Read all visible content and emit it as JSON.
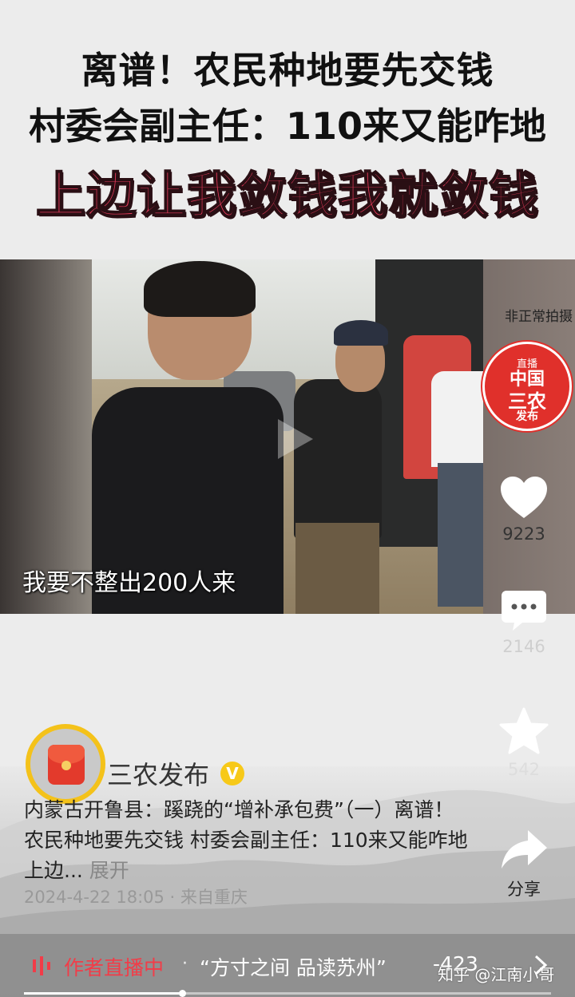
{
  "headline": {
    "line1": "离谱！农民种地要先交钱",
    "line2": "村委会副主任：110来又能咋地",
    "line3": "上边让我敛钱我就敛钱"
  },
  "video": {
    "subtitle": "我要不整出200人来",
    "watermark": "非正常拍摄"
  },
  "stamp": {
    "top": "直播",
    "line1": "中国",
    "line2": "三农",
    "line3": "发布"
  },
  "actions": {
    "likes": "9223",
    "comments": "2146",
    "favorites": "542",
    "share_label": "分享"
  },
  "author": {
    "name": "三农发布",
    "verified_mark": "V"
  },
  "post": {
    "description": "内蒙古开鲁县：蹊跷的“增补承包费”（一）离谱！农民种地要先交钱 村委会副主任：110来又能咋地 上边...",
    "expand_label": "展开",
    "time_location": "2024-4-22 18:05 · 来自重庆"
  },
  "live_bar": {
    "status": "作者直播中",
    "separator": "·",
    "title": "“方寸之间 品读苏州”",
    "count": "-423"
  },
  "zhihu_watermark": "知乎 @江南小哥",
  "progress": {
    "played_fraction": 0.3
  },
  "colors": {
    "headline_red": "#e23a5a",
    "live_red": "#f23c48",
    "verified_yellow": "#f7c919",
    "stamp_red": "#e0302b"
  }
}
